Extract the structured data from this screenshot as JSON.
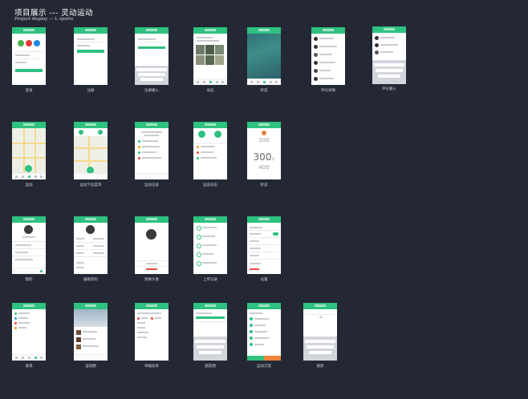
{
  "header": {
    "title": "项目展示 --- 灵动运动",
    "subtitle": "Project display --- L sports"
  },
  "screens": [
    {
      "id": "login",
      "caption": "登录"
    },
    {
      "id": "register",
      "caption": "注册"
    },
    {
      "id": "phone-input",
      "caption": "注册输入"
    },
    {
      "id": "dynamic",
      "caption": "动态"
    },
    {
      "id": "detail",
      "caption": "听说"
    },
    {
      "id": "comment-detail",
      "caption": "评论详情"
    },
    {
      "id": "comment-input",
      "caption": "评论输入"
    },
    {
      "id": "sports",
      "caption": "运动"
    },
    {
      "id": "sports-select",
      "caption": "运动下拉菜单"
    },
    {
      "id": "sports-record",
      "caption": "运动记录"
    },
    {
      "id": "sports-log",
      "caption": "运动日志"
    },
    {
      "id": "numbers",
      "caption": "听说"
    },
    {
      "id": "mine",
      "caption": "我的"
    },
    {
      "id": "edit-profile",
      "caption": "编辑资料"
    },
    {
      "id": "change-avatar",
      "caption": "更换头像"
    },
    {
      "id": "upload-records",
      "caption": "上传记录"
    },
    {
      "id": "settings",
      "caption": "设置"
    },
    {
      "id": "discover",
      "caption": "发现"
    },
    {
      "id": "sports-circle",
      "caption": "运动圈"
    },
    {
      "id": "feedback",
      "caption": "举报投诉"
    },
    {
      "id": "friends",
      "caption": "朋友圈"
    },
    {
      "id": "sports-plan",
      "caption": "运动方案"
    },
    {
      "id": "search",
      "caption": "搜索"
    }
  ],
  "number_picker": {
    "top": "200",
    "middle": "300",
    "unit": "步",
    "bottom": "400"
  },
  "colors": {
    "background": "#242834",
    "accent": "#2ec17f",
    "card": "#ffffff"
  }
}
